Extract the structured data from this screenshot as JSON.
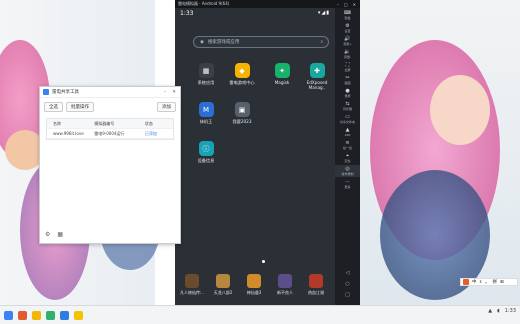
{
  "emulator": {
    "title": "雷电模拟器 · Android 9(64)",
    "status_time": "1:33",
    "search_placeholder": "搜索游戏或应用",
    "apps": [
      {
        "label": "系统应用",
        "icon": "system-apps-icon",
        "color": "#3a3f48"
      },
      {
        "label": "雷电游戏中心",
        "icon": "game-center-icon",
        "color": "#f5b400"
      },
      {
        "label": "Magisk",
        "icon": "magisk-icon",
        "color": "#18b26b"
      },
      {
        "label": "EdXposed Manag..",
        "icon": "edxposed-icon",
        "color": "#1aa7a0"
      },
      {
        "label": "抹机王",
        "icon": "wipe-king-icon",
        "color": "#2b6fd6"
      },
      {
        "label": "我要2023",
        "icon": "app-2023-icon",
        "color": "#58606b"
      },
      {
        "label": "设备信息",
        "icon": "device-info-icon",
        "color": "#17a2b8"
      }
    ],
    "dock": [
      {
        "label": "凡人修仙传:..",
        "color": "#6a4b2c"
      },
      {
        "label": "天龙八部2",
        "color": "#b8873e"
      },
      {
        "label": "神仙道3",
        "color": "#d08b2a"
      },
      {
        "label": "新不良人",
        "color": "#5b4e8a"
      },
      {
        "label": "热血江湖",
        "color": "#b33a2a"
      }
    ],
    "sidebar": [
      "键盘",
      "设置",
      "音量+",
      "音量-",
      "全屏",
      "截图",
      "录屏",
      "同步器",
      "共享文件夹",
      "APK",
      "摇一摇",
      "定位",
      "操作录制",
      "更多"
    ]
  },
  "window": {
    "title": "雷电共享工具",
    "tabs": [
      "全选",
      "批量操作"
    ],
    "right_button": "添加",
    "columns": [
      "名称",
      "模拟器编号",
      "状态"
    ],
    "rows": [
      {
        "name": "www.996it.love",
        "id": "雷电9-0004运行",
        "status": "已添加"
      }
    ],
    "footer_icons": [
      "settings-icon",
      "grid-icon"
    ]
  },
  "taskbar": {
    "clock": "1:33",
    "ime": [
      "中",
      "ε",
      "。",
      "拼",
      "⊞"
    ]
  },
  "colors": {
    "accent": "#2f7de1",
    "emulator_bg": "#2b2f36"
  }
}
